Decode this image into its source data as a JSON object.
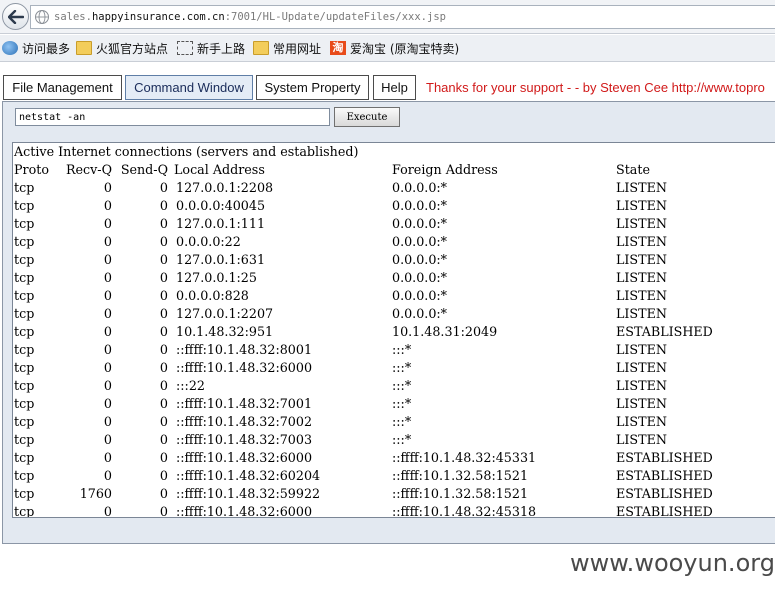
{
  "browser": {
    "url_prefix": "sales.",
    "url_domain": "happyinsurance.com.cn",
    "url_suffix": ":7001/HL-Update/updateFiles/xxx.jsp"
  },
  "bookmarks": [
    {
      "label": "访问最多",
      "icon": "globe-icon"
    },
    {
      "label": "火狐官方站点",
      "icon": "folder-icon"
    },
    {
      "label": "新手上路",
      "icon": "dotted-square-icon"
    },
    {
      "label": "常用网址",
      "icon": "folder-icon"
    },
    {
      "label": "爱淘宝 (原淘宝特卖)",
      "icon": "taobao-icon",
      "icon_text": "淘"
    }
  ],
  "tabs": {
    "file": "File Management",
    "command": "Command Window",
    "system": "System Property",
    "help": "Help"
  },
  "thanks": "Thanks for your support - - by Steven Cee http://www.topro",
  "command": {
    "value": "netstat -an",
    "execute_label": "Execute"
  },
  "output": {
    "heading": "Active Internet connections (servers and established)",
    "columns": [
      "Proto",
      "Recv-Q",
      "Send-Q",
      "Local Address",
      "Foreign Address",
      "State"
    ],
    "rows": [
      [
        "tcp",
        "0",
        "0",
        "127.0.0.1:2208",
        "0.0.0.0:*",
        "LISTEN"
      ],
      [
        "tcp",
        "0",
        "0",
        "0.0.0.0:40045",
        "0.0.0.0:*",
        "LISTEN"
      ],
      [
        "tcp",
        "0",
        "0",
        "127.0.0.1:111",
        "0.0.0.0:*",
        "LISTEN"
      ],
      [
        "tcp",
        "0",
        "0",
        "0.0.0.0:22",
        "0.0.0.0:*",
        "LISTEN"
      ],
      [
        "tcp",
        "0",
        "0",
        "127.0.0.1:631",
        "0.0.0.0:*",
        "LISTEN"
      ],
      [
        "tcp",
        "0",
        "0",
        "127.0.0.1:25",
        "0.0.0.0:*",
        "LISTEN"
      ],
      [
        "tcp",
        "0",
        "0",
        "0.0.0.0:828",
        "0.0.0.0:*",
        "LISTEN"
      ],
      [
        "tcp",
        "0",
        "0",
        "127.0.0.1:2207",
        "0.0.0.0:*",
        "LISTEN"
      ],
      [
        "tcp",
        "0",
        "0",
        "10.1.48.32:951",
        "10.1.48.31:2049",
        "ESTABLISHED"
      ],
      [
        "tcp",
        "0",
        "0",
        "::ffff:10.1.48.32:8001",
        ":::*",
        "LISTEN"
      ],
      [
        "tcp",
        "0",
        "0",
        "::ffff:10.1.48.32:6000",
        ":::*",
        "LISTEN"
      ],
      [
        "tcp",
        "0",
        "0",
        ":::22",
        ":::*",
        "LISTEN"
      ],
      [
        "tcp",
        "0",
        "0",
        "::ffff:10.1.48.32:7001",
        ":::*",
        "LISTEN"
      ],
      [
        "tcp",
        "0",
        "0",
        "::ffff:10.1.48.32:7002",
        ":::*",
        "LISTEN"
      ],
      [
        "tcp",
        "0",
        "0",
        "::ffff:10.1.48.32:7003",
        ":::*",
        "LISTEN"
      ],
      [
        "tcp",
        "0",
        "0",
        "::ffff:10.1.48.32:6000",
        "::ffff:10.1.48.32:45331",
        "ESTABLISHED"
      ],
      [
        "tcp",
        "0",
        "0",
        "::ffff:10.1.48.32:60204",
        "::ffff:10.1.32.58:1521",
        "ESTABLISHED"
      ],
      [
        "tcp",
        "1760",
        "0",
        "::ffff:10.1.48.32:59922",
        "::ffff:10.1.32.58:1521",
        "ESTABLISHED"
      ],
      [
        "tcp",
        "0",
        "0",
        "::ffff:10.1.48.32:6000",
        "::ffff:10.1.48.32:45318",
        "ESTABLISHED"
      ]
    ]
  },
  "watermark": "www.wooyun.org",
  "colors": {
    "thanks": "#d11a1a",
    "panel": "#e3e9f1",
    "active_tab": "#e4ecf6"
  }
}
